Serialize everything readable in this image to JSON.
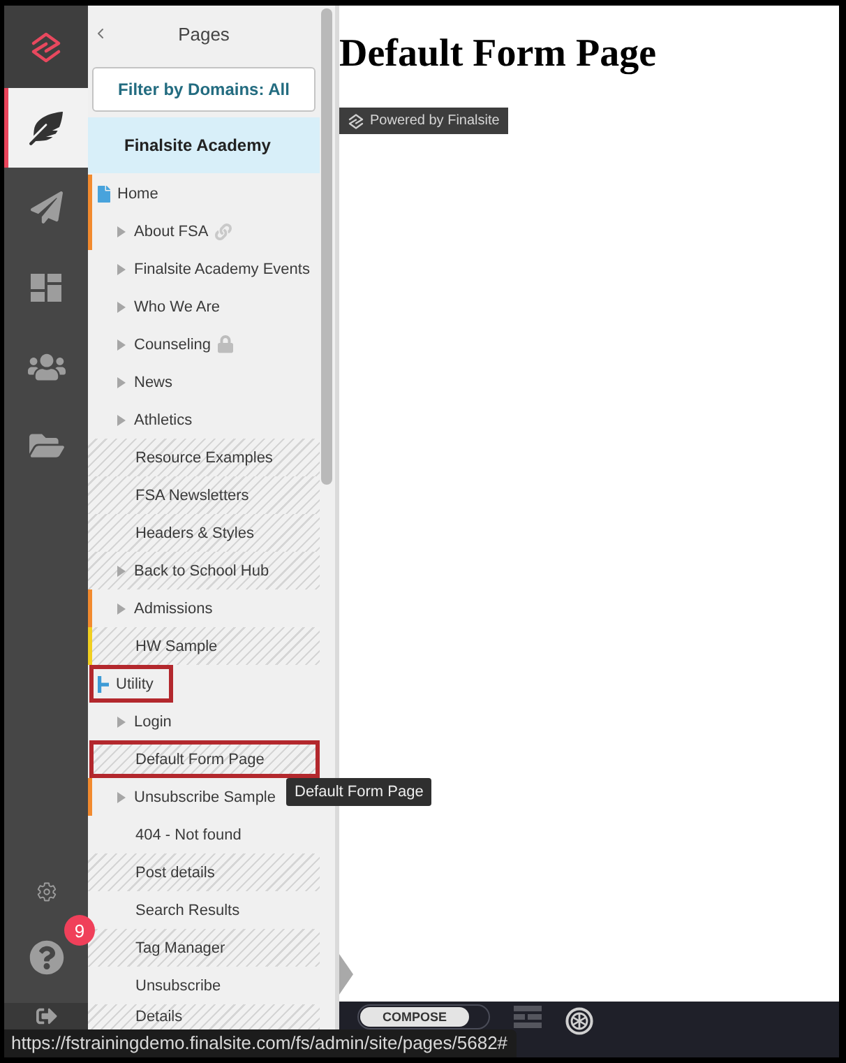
{
  "nav": {
    "items": [
      {
        "kind": "pages",
        "selected": true
      },
      {
        "kind": "publish",
        "selected": false
      },
      {
        "kind": "layouts",
        "selected": false
      },
      {
        "kind": "people",
        "selected": false
      },
      {
        "kind": "files",
        "selected": false
      }
    ],
    "help_badge": "9"
  },
  "sidebar": {
    "title": "Pages",
    "filter_button": "Filter by Domains: All",
    "domain": "Finalsite Academy",
    "tree": [
      {
        "label": "Home",
        "kind": "page",
        "color": "#f28a2e",
        "striped": false,
        "annotated": false,
        "children": [
          {
            "label": "About FSA",
            "has_children": true,
            "striped": false,
            "linked": true,
            "locked": false,
            "annotated": false,
            "color": "#f28a2e"
          },
          {
            "label": "Finalsite Academy Events",
            "has_children": true,
            "striped": false,
            "linked": false,
            "locked": false,
            "annotated": false
          },
          {
            "label": "Who We Are",
            "has_children": true,
            "striped": false,
            "linked": false,
            "locked": false,
            "annotated": false
          },
          {
            "label": "Counseling",
            "has_children": true,
            "striped": false,
            "linked": false,
            "locked": true,
            "annotated": false
          },
          {
            "label": "News",
            "has_children": true,
            "striped": false,
            "linked": false,
            "locked": false,
            "annotated": false
          },
          {
            "label": "Athletics",
            "has_children": true,
            "striped": false,
            "linked": false,
            "locked": false,
            "annotated": false
          },
          {
            "label": "Resource Examples",
            "has_children": false,
            "striped": true,
            "linked": false,
            "locked": false,
            "annotated": false
          },
          {
            "label": "FSA Newsletters",
            "has_children": false,
            "striped": true,
            "linked": false,
            "locked": false,
            "annotated": false
          },
          {
            "label": "Headers & Styles",
            "has_children": false,
            "striped": true,
            "linked": false,
            "locked": false,
            "annotated": false
          },
          {
            "label": "Back to School Hub",
            "has_children": true,
            "striped": true,
            "linked": false,
            "locked": false,
            "annotated": false
          },
          {
            "label": "Admissions",
            "has_children": true,
            "striped": false,
            "linked": false,
            "locked": false,
            "annotated": false,
            "color": "#f28a2e"
          },
          {
            "label": "HW Sample",
            "has_children": false,
            "striped": true,
            "linked": false,
            "locked": false,
            "annotated": false,
            "color": "#f1cf1f"
          }
        ]
      },
      {
        "label": "Utility",
        "kind": "section",
        "striped": false,
        "annotated": true,
        "children": [
          {
            "label": "Login",
            "has_children": true,
            "striped": false,
            "linked": false,
            "locked": false,
            "annotated": false
          },
          {
            "label": "Default Form Page",
            "has_children": false,
            "striped": true,
            "linked": false,
            "locked": false,
            "annotated": true
          },
          {
            "label": "Unsubscribe Sample",
            "has_children": true,
            "striped": false,
            "linked": false,
            "locked": false,
            "annotated": false,
            "color": "#f28a2e"
          },
          {
            "label": "404 - Not found",
            "has_children": false,
            "striped": false,
            "linked": false,
            "locked": false,
            "annotated": false
          },
          {
            "label": "Post details",
            "has_children": false,
            "striped": true,
            "linked": false,
            "locked": false,
            "annotated": false
          },
          {
            "label": "Search Results",
            "has_children": false,
            "striped": false,
            "linked": false,
            "locked": false,
            "annotated": false
          },
          {
            "label": "Tag Manager",
            "has_children": false,
            "striped": true,
            "linked": false,
            "locked": false,
            "annotated": false
          },
          {
            "label": "Unsubscribe",
            "has_children": false,
            "striped": false,
            "linked": false,
            "locked": false,
            "annotated": false
          },
          {
            "label": "Details",
            "has_children": false,
            "striped": true,
            "linked": false,
            "locked": false,
            "annotated": false
          }
        ]
      }
    ]
  },
  "tooltip": "Default Form Page",
  "page": {
    "title": "Default Form Page",
    "powered_by": "Powered by Finalsite"
  },
  "toolbar": {
    "compose_button": "COMPOSE",
    "compose_selected": true
  },
  "status_url": "https://fstrainingdemo.finalsite.com/fs/admin/site/pages/5682#"
}
